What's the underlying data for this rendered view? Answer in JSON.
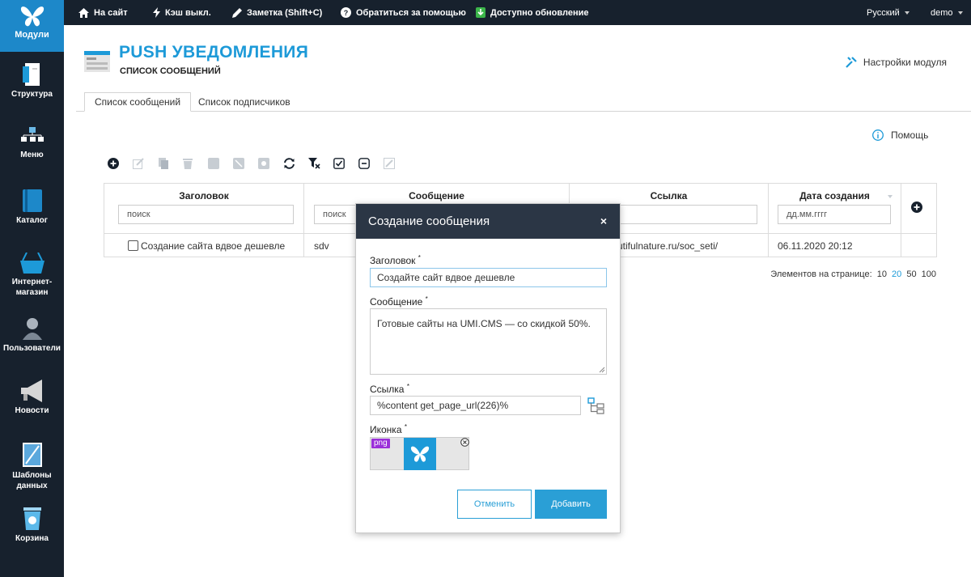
{
  "topbar": {
    "logo_label": "Модули",
    "items": [
      {
        "label": "На сайт",
        "icon": "home-icon"
      },
      {
        "label": "Кэш выкл.",
        "icon": "bolt-icon"
      },
      {
        "label": "Заметка (Shift+C)",
        "icon": "pencil-icon"
      },
      {
        "label": "Обратиться за помощью",
        "icon": "question-icon"
      },
      {
        "label": "Доступно обновление",
        "icon": "update-icon"
      }
    ],
    "language": "Русский",
    "user": "demo"
  },
  "sidebar": {
    "items": [
      {
        "label": "Структура",
        "icon": "structure-icon"
      },
      {
        "label": "Меню",
        "icon": "menu-tree-icon"
      },
      {
        "label": "Каталог",
        "icon": "catalog-book-icon"
      },
      {
        "label": "Интернет-магазин",
        "icon": "basket-icon"
      },
      {
        "label": "Пользователи",
        "icon": "user-icon"
      },
      {
        "label": "Новости",
        "icon": "megaphone-icon"
      },
      {
        "label": "Шаблоны данных",
        "icon": "template-icon"
      },
      {
        "label": "Корзина",
        "icon": "trash-bin-icon"
      }
    ]
  },
  "header": {
    "title": "PUSH УВЕДОМЛЕНИЯ",
    "subtitle": "СПИСОК СООБЩЕНИЙ",
    "settings_label": "Настройки модуля"
  },
  "tabs": [
    {
      "label": "Список сообщений",
      "active": true
    },
    {
      "label": "Список подписчиков",
      "active": false
    }
  ],
  "help_label": "Помощь",
  "table": {
    "columns": [
      {
        "title": "Заголовок",
        "filter_placeholder": "поиск"
      },
      {
        "title": "Сообщение",
        "filter_placeholder": "поиск"
      },
      {
        "title": "Ссылка",
        "filter_placeholder": ""
      },
      {
        "title": "Дата создания",
        "filter_placeholder": "дд.мм.гггг"
      }
    ],
    "rows": [
      {
        "title": "Создание сайта вдвое дешевле",
        "message": "sdv",
        "link": "utifulnature.ru/soc_seti/",
        "date": "06.11.2020 20:12"
      }
    ]
  },
  "paging": {
    "label": "Элементов на странице:",
    "options": [
      "10",
      "20",
      "50",
      "100"
    ],
    "current": "20"
  },
  "modal": {
    "title": "Создание сообщения",
    "close": "×",
    "fields": {
      "title_label": "Заголовок",
      "title_value": "Создайте сайт вдвое дешевле",
      "message_label": "Сообщение",
      "message_value": "Готовые сайты на UMI.CMS — со скидкой 50%.",
      "link_label": "Ссылка",
      "link_value": "%content get_page_url(226)%",
      "icon_label": "Иконка",
      "icon_badge": "png",
      "required_mark": "*"
    },
    "cancel_label": "Отменить",
    "submit_label": "Добавить"
  },
  "colors": {
    "accent": "#1d9ad8",
    "dark": "#17212d",
    "modal_header": "#2b3645",
    "button": "#2a9fd6",
    "badge": "#9b30d9"
  }
}
